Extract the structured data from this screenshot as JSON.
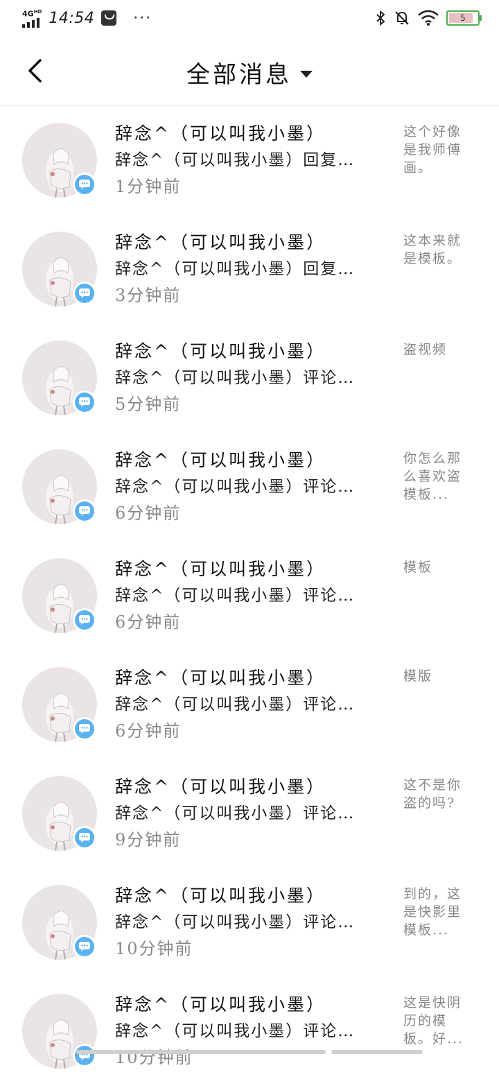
{
  "status_bar": {
    "network": "4G",
    "network_suffix": "HD",
    "time": "14:54",
    "more": "···",
    "battery_level": "5",
    "icons": [
      "signal-icon",
      "mail-icon",
      "bluetooth-icon",
      "mute-icon",
      "wifi-icon",
      "battery-icon"
    ]
  },
  "header": {
    "title": "全部消息",
    "back_icon": "back-arrow-icon",
    "dropdown_icon": "caret-down-icon"
  },
  "messages": [
    {
      "name": "辞念^（可以叫我小墨）",
      "summary": "辞念^（可以叫我小墨）回复…",
      "time": "1分钟前",
      "quote": "这个好像是我师傅画。"
    },
    {
      "name": "辞念^（可以叫我小墨）",
      "summary": "辞念^（可以叫我小墨）回复…",
      "time": "3分钟前",
      "quote": "这本来就是模板。"
    },
    {
      "name": "辞念^（可以叫我小墨）",
      "summary": "辞念^（可以叫我小墨）评论…",
      "time": "5分钟前",
      "quote": "盗视频"
    },
    {
      "name": "辞念^（可以叫我小墨）",
      "summary": "辞念^（可以叫我小墨）评论…",
      "time": "6分钟前",
      "quote": "你怎么那么喜欢盗模板..."
    },
    {
      "name": "辞念^（可以叫我小墨）",
      "summary": "辞念^（可以叫我小墨）评论…",
      "time": "6分钟前",
      "quote": "模板"
    },
    {
      "name": "辞念^（可以叫我小墨）",
      "summary": "辞念^（可以叫我小墨）评论…",
      "time": "6分钟前",
      "quote": "模版"
    },
    {
      "name": "辞念^（可以叫我小墨）",
      "summary": "辞念^（可以叫我小墨）评论…",
      "time": "9分钟前",
      "quote": "这不是你盗的吗?"
    },
    {
      "name": "辞念^（可以叫我小墨）",
      "summary": "辞念^（可以叫我小墨）评论…",
      "time": "10分钟前",
      "quote": "到的，这是快影里模板..."
    },
    {
      "name": "辞念^（可以叫我小墨）",
      "summary": "辞念^（可以叫我小墨）评论…",
      "time": "10分钟前",
      "quote": "这是快阴历的模板。好..."
    }
  ]
}
